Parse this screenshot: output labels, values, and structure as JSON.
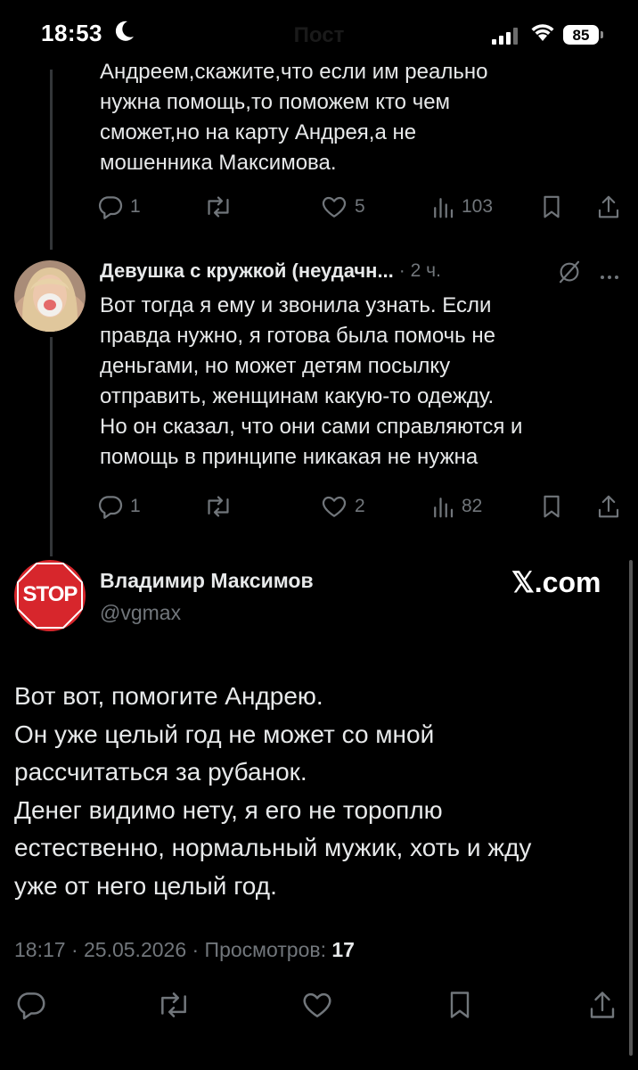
{
  "status_bar": {
    "time": "18:53",
    "battery": "85",
    "title": "Пост"
  },
  "tweet1": {
    "text": "Андреем,скажите,что если им реально\nнужна помощь,то поможем кто чем\nсможет,но на карту Андрея,а не\nмошенника Максимова.",
    "replies": "1",
    "reposts": "",
    "likes": "5",
    "views": "103"
  },
  "tweet2": {
    "author": "Девушка с кружкой (неудачн...",
    "time": "· 2 ч.",
    "text": "Вот тогда я ему и звонила узнать. Если\nправда нужно, я готова была помочь не\nденьгами, но может детям посылку\nотправить, женщинам какую-то одежду.\nНо он сказал, что они сами справляются и\nпомощь в принципе никакая не нужна",
    "replies": "1",
    "reposts": "",
    "likes": "2",
    "views": "82"
  },
  "embed": {
    "author": "Владимир Максимов",
    "handle": "@vgmax",
    "avatar_text": "STOP",
    "brand": "𝕏.com",
    "text": "Вот вот, помогите Андрею.\nОн уже целый год не может со мной\nрассчитаться за рубанок.\nДенег видимо нету, я его не тороплю\nестественно, нормальный мужик, хоть и жду\nуже от него целый год.",
    "timestamp": "18:17 · 25.05.2026 · Просмотров: ",
    "views": "17"
  },
  "colors": {
    "background": "#000000",
    "text": "#e7e9ea",
    "secondary": "#71767b",
    "stop_red": "#d7262c"
  },
  "icons": [
    "reply-icon",
    "repost-icon",
    "like-icon",
    "views-icon",
    "bookmark-icon",
    "share-icon",
    "grok-icon",
    "more-icon",
    "moon-icon",
    "signal-icon",
    "wifi-icon",
    "battery-icon"
  ]
}
